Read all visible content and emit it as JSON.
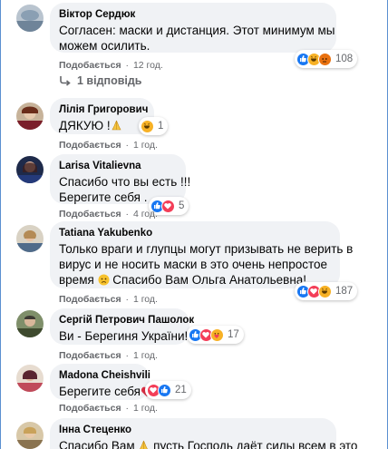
{
  "common": {
    "like_label": "Подобається",
    "separator": "·"
  },
  "comments": [
    {
      "author": "Віктор Сердюк",
      "text_lines": [
        "Согласен: маски и дистанция. Этот минимум мы",
        "можем осилить."
      ],
      "time": "12 год.",
      "reaction_count": "108",
      "reactions": [
        "like-icon",
        "haha-icon",
        "angry-icon"
      ],
      "replies": "1 відповідь"
    },
    {
      "author": "Лілія Григорович",
      "text_lines": [
        "ДЯКУЮ !"
      ],
      "time": "1 год.",
      "reaction_count": "1",
      "reactions": [
        "haha-icon"
      ]
    },
    {
      "author": "Larisa Vitalievna",
      "text_lines": [
        "Спасибо что вы есть !!!",
        "Берегите себя ."
      ],
      "time": "4 год.",
      "reaction_count": "5",
      "reactions": [
        "like-icon",
        "love-icon"
      ]
    },
    {
      "author": "Tatiana Yakubenko",
      "text_lines": [
        "Только враги и глупцы могут призывать не верить в",
        "вирус и не носить маски в это очень непростое",
        "время",
        " Спасибо Вам Ольга Анатольевна!"
      ],
      "time": "1 год.",
      "reaction_count": "187",
      "reactions": [
        "like-icon",
        "love-icon",
        "haha-icon"
      ]
    },
    {
      "author": "Сергій Петрович Пашолок",
      "text_lines": [
        "Ви - Берегиня України!"
      ],
      "time": "1 год.",
      "reaction_count": "17",
      "reactions": [
        "like-icon",
        "love-icon",
        "care-icon"
      ]
    },
    {
      "author": "Madona Cheishvili",
      "text_lines": [
        "Берегите себя"
      ],
      "time": "1 год.",
      "reaction_count": "21",
      "reactions": [
        "love-icon",
        "like-icon"
      ]
    },
    {
      "author": "Інна Стеценко",
      "text_lines": [
        "Спасибо Вам ",
        " пусть Господь даёт силы всем в это"
      ],
      "time": "",
      "reaction_count": "",
      "reactions": []
    }
  ],
  "colors": {
    "bubble": "#f0f2f5",
    "meta": "#65676b",
    "like_blue": "#1877f2",
    "love_red": "#f33e58",
    "haha_yellow": "#f7b125",
    "angry_orange": "#e9710f"
  }
}
